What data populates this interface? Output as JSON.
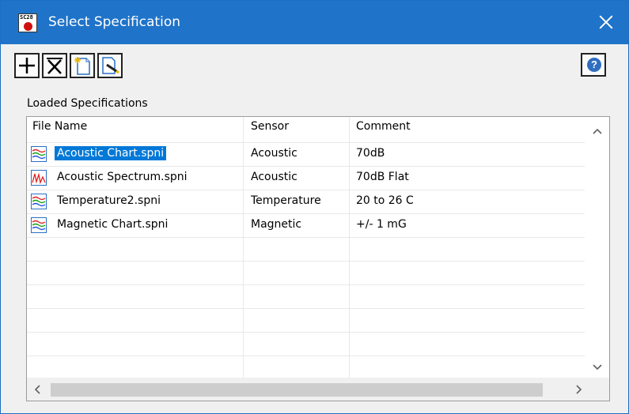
{
  "window": {
    "title": "Select Specification",
    "app_icon_text": "SC28"
  },
  "toolbar": {
    "buttons": [
      {
        "name": "add",
        "icon": "plus-icon"
      },
      {
        "name": "remove",
        "icon": "delete-x-icon"
      },
      {
        "name": "new",
        "icon": "new-file-icon"
      },
      {
        "name": "edit",
        "icon": "edit-file-icon"
      }
    ],
    "help_icon": "help-icon",
    "help_label": "?"
  },
  "section_label": "Loaded Specifications",
  "table": {
    "columns": [
      "File Name",
      "Sensor",
      "Comment"
    ],
    "rows": [
      {
        "file": "Acoustic Chart.spni",
        "sensor": "Acoustic",
        "comment": "70dB",
        "icon": "chart-file-icon",
        "selected": true
      },
      {
        "file": "Acoustic Spectrum.spni",
        "sensor": "Acoustic",
        "comment": "70dB Flat",
        "icon": "spectrum-file-icon",
        "selected": false
      },
      {
        "file": "Temperature2.spni",
        "sensor": "Temperature",
        "comment": "20 to 26 C",
        "icon": "chart-file-icon",
        "selected": false
      },
      {
        "file": "Magnetic Chart.spni",
        "sensor": "Magnetic",
        "comment": "+/- 1 mG",
        "icon": "chart-file-icon",
        "selected": false
      }
    ]
  },
  "colors": {
    "titlebar": "#1f73c9",
    "selection": "#0078d7"
  }
}
